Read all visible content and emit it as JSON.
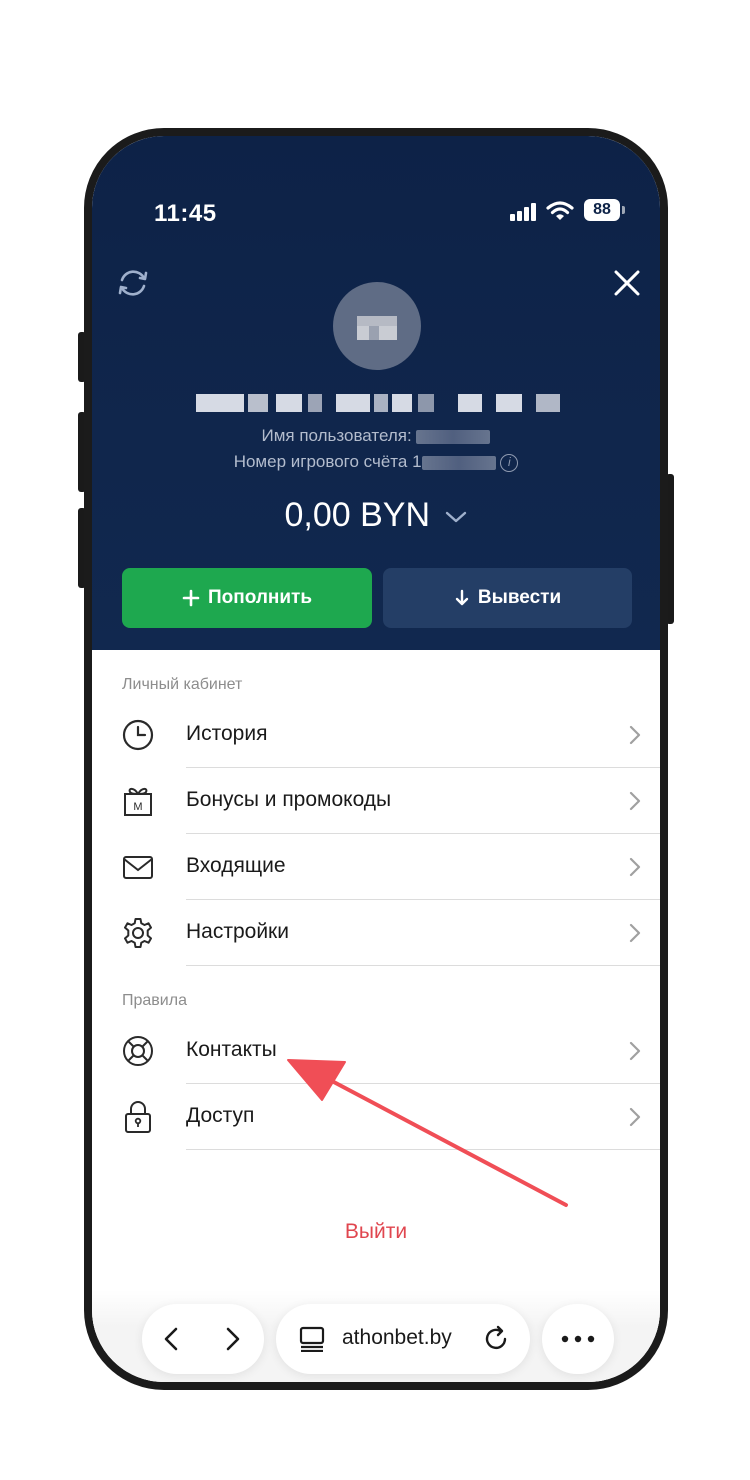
{
  "status_bar": {
    "time": "11:45",
    "battery": "88"
  },
  "header": {
    "username_label": "Имя пользователя:",
    "account_label": "Номер игрового счёта",
    "account_prefix": "1",
    "balance": "0,00 BYN"
  },
  "actions": {
    "deposit": "Пополнить",
    "withdraw": "Вывести"
  },
  "sections": {
    "personal": "Личный кабинет",
    "rules": "Правила"
  },
  "menu": {
    "history": "История",
    "bonuses": "Бонусы и промокоды",
    "inbox": "Входящие",
    "settings": "Настройки",
    "contacts": "Контакты",
    "access": "Доступ"
  },
  "logout": "Выйти",
  "browser": {
    "url": "athonbet.by"
  },
  "colors": {
    "header_bg": "#0d2247",
    "deposit_bg": "#1ea84f",
    "withdraw_bg": "#243e66",
    "logout": "#e0464f",
    "annotation_arrow": "#f04e56"
  }
}
